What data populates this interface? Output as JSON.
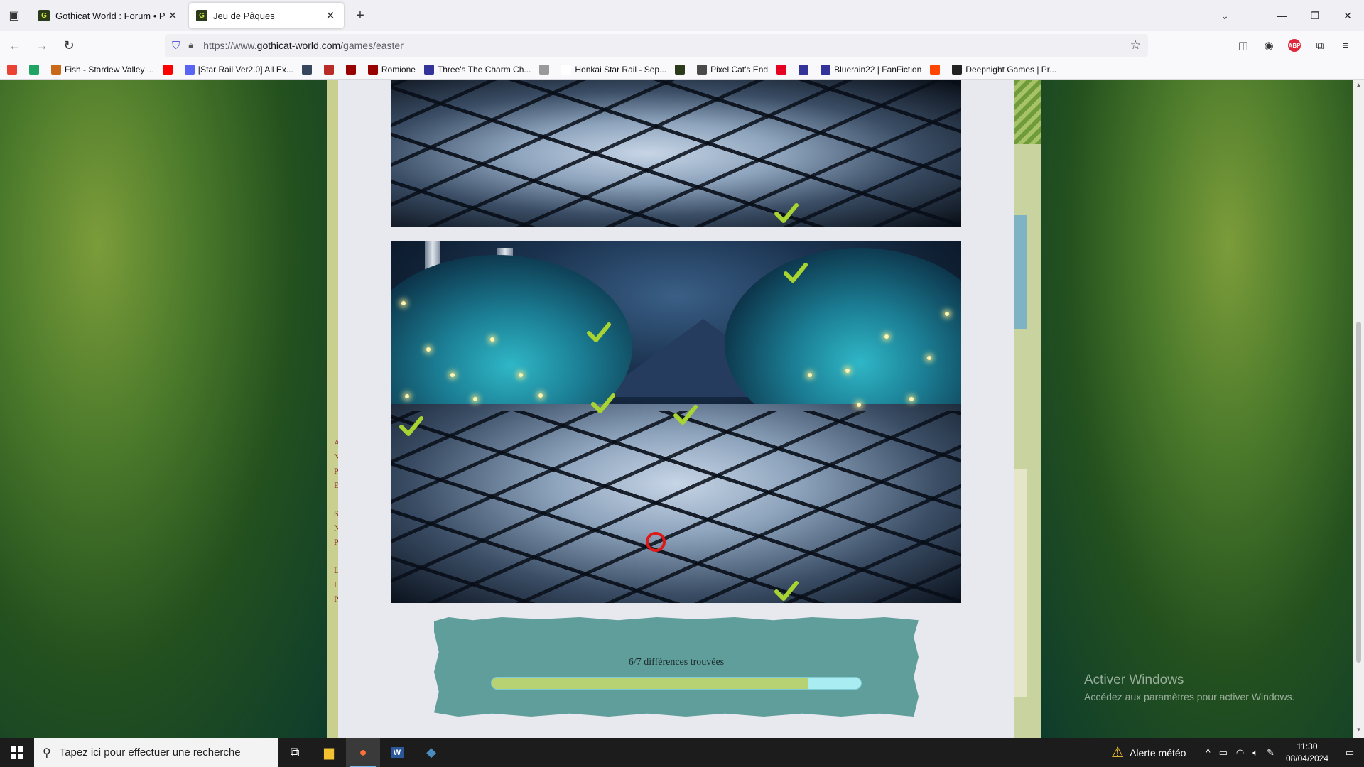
{
  "browser": {
    "tabs": [
      {
        "title": "Gothicat World : Forum • Publi",
        "active": false
      },
      {
        "title": "Jeu de Pâques",
        "active": true
      }
    ],
    "url_prefix": "https://www.",
    "url_domain": "gothicat-world.com",
    "url_path": "/games/easter",
    "bookmarks": [
      {
        "label": "",
        "icon": "gmail-icon",
        "color": "#ea4335"
      },
      {
        "label": "",
        "icon": "google-drive-icon",
        "color": "#1fa463"
      },
      {
        "label": "Fish - Stardew Valley ...",
        "icon": "stardew-icon",
        "color": "#c86a1a"
      },
      {
        "label": "",
        "icon": "youtube-icon",
        "color": "#ff0000"
      },
      {
        "label": "[Star Rail Ver2.0] All Ex...",
        "icon": "discord-icon",
        "color": "#5865f2"
      },
      {
        "label": "",
        "icon": "tumblr-icon",
        "color": "#36465d"
      },
      {
        "label": "",
        "icon": "quora-icon",
        "color": "#b92b27"
      },
      {
        "label": "",
        "icon": "ao3-icon",
        "color": "#990000"
      },
      {
        "label": "Romione",
        "icon": "ao3-icon",
        "color": "#990000"
      },
      {
        "label": "Three's The Charm Ch...",
        "icon": "fanfiction-icon",
        "color": "#333399"
      },
      {
        "label": "",
        "icon": "anime-icon",
        "color": "#999999"
      },
      {
        "label": "Honkai Star Rail - Sep...",
        "icon": "blank-icon",
        "color": "#ffffff"
      },
      {
        "label": "",
        "icon": "gothicat-icon",
        "color": "#2b3a1a"
      },
      {
        "label": "Pixel Cat's End",
        "icon": "pixelcat-icon",
        "color": "#4a4a4a"
      },
      {
        "label": "",
        "icon": "pinterest-icon",
        "color": "#e60023"
      },
      {
        "label": "",
        "icon": "fanfiction-icon",
        "color": "#333399"
      },
      {
        "label": "Bluerain22 | FanFiction",
        "icon": "fanfiction-icon",
        "color": "#333399"
      },
      {
        "label": "",
        "icon": "reddit-icon",
        "color": "#ff4500"
      },
      {
        "label": "Deepnight Games | Pr...",
        "icon": "deepnight-icon",
        "color": "#222222"
      }
    ]
  },
  "game": {
    "progress_text": "6/7 différences trouvées",
    "found": 6,
    "total": 7,
    "bar_fill_color": "#b7d273",
    "bar_track_color": "#a9ecf2"
  },
  "windows": {
    "activate_title": "Activer Windows",
    "activate_sub": "Accédez aux paramètres pour activer Windows.",
    "search_placeholder": "Tapez ici pour effectuer une recherche",
    "weather": "Alerte météo",
    "time": "11:30",
    "date": "08/04/2024"
  },
  "forum_letters": [
    "A",
    "N",
    "P",
    "E",
    "",
    "S",
    "N",
    "P",
    "",
    "L",
    "L",
    "P"
  ]
}
